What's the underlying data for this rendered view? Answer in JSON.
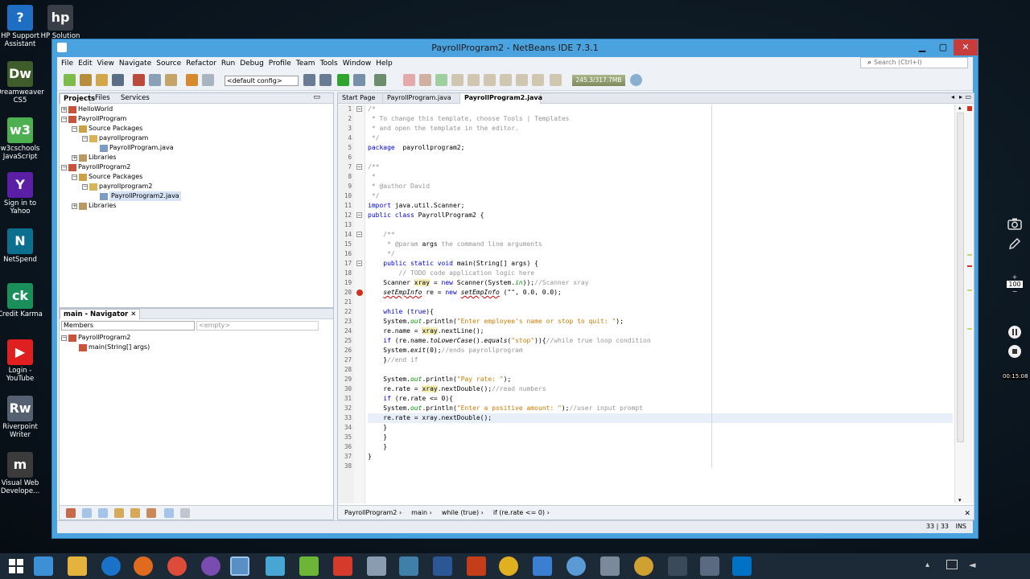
{
  "desktop": {
    "icons": [
      {
        "label": "HP Support Assistant",
        "color": "#1e6fc4",
        "glyph": "?"
      },
      {
        "label": "HP Solution",
        "color": "#3a3f47",
        "glyph": "hp"
      },
      {
        "label": "Dreamweaver CS5",
        "color": "#3e5d2a",
        "glyph": "Dw"
      },
      {
        "label": "w3cschools JavaScript",
        "color": "#4caf50",
        "glyph": "w3"
      },
      {
        "label": "Sign in to Yahoo",
        "color": "#5b1fa6",
        "glyph": "Y"
      },
      {
        "label": "NetSpend",
        "color": "#0d6f8f",
        "glyph": "N"
      },
      {
        "label": "Credit Karma",
        "color": "#1a8f5a",
        "glyph": "ck"
      },
      {
        "label": "Login - YouTube",
        "color": "#e02020",
        "glyph": "▶"
      },
      {
        "label": "Riverpoint Writer",
        "color": "#556070",
        "glyph": "Rw"
      },
      {
        "label": "Visual Web Develope...",
        "color": "#3b3b3b",
        "glyph": "m"
      }
    ],
    "side_tools": {
      "zoom": "100",
      "timer": "00:15:08"
    }
  },
  "window": {
    "title": "PayrollProgram2 - NetBeans IDE 7.3.1",
    "menu": [
      "File",
      "Edit",
      "View",
      "Navigate",
      "Source",
      "Refactor",
      "Run",
      "Debug",
      "Profile",
      "Team",
      "Tools",
      "Window",
      "Help"
    ],
    "search_placeholder": "Search (Ctrl+I)",
    "config": "<default config>",
    "memory": "245.3/317.7MB"
  },
  "projects": {
    "tabs": [
      "Projects",
      "Files",
      "Services"
    ],
    "tree": [
      {
        "label": "HelloWorld",
        "depth": 0,
        "kind": "project",
        "exp": "+"
      },
      {
        "label": "PayrollProgram",
        "depth": 0,
        "kind": "project",
        "exp": "−"
      },
      {
        "label": "Source Packages",
        "depth": 1,
        "kind": "folder",
        "exp": "−"
      },
      {
        "label": "payrollprogram",
        "depth": 2,
        "kind": "package",
        "exp": "−"
      },
      {
        "label": "PayrollProgram.java",
        "depth": 3,
        "kind": "java",
        "exp": ""
      },
      {
        "label": "Libraries",
        "depth": 1,
        "kind": "lib",
        "exp": "+"
      },
      {
        "label": "PayrollProgram2",
        "depth": 0,
        "kind": "project",
        "exp": "−"
      },
      {
        "label": "Source Packages",
        "depth": 1,
        "kind": "folder",
        "exp": "−"
      },
      {
        "label": "payrollprogram2",
        "depth": 2,
        "kind": "package",
        "exp": "−"
      },
      {
        "label": "PayrollProgram2.java",
        "depth": 3,
        "kind": "java",
        "exp": "",
        "selected": true
      },
      {
        "label": "Libraries",
        "depth": 1,
        "kind": "lib",
        "exp": "+"
      }
    ]
  },
  "navigator": {
    "title": "main - Navigator",
    "filter": "Members",
    "filter2": "<empty>",
    "tree": [
      {
        "label": "PayrollProgram2",
        "depth": 0
      },
      {
        "label": "main(String[] args)",
        "depth": 1
      }
    ]
  },
  "editor": {
    "tabs": [
      {
        "label": "Start Page",
        "active": false
      },
      {
        "label": "PayrollProgram.java",
        "active": false
      },
      {
        "label": "PayrollProgram2.java",
        "active": true
      }
    ],
    "current_line": 33,
    "breadcrumb": [
      "PayrollProgram2",
      "main",
      "while (true)",
      "if (re.rate <= 0)"
    ],
    "status_pos": "33 | 33",
    "status_mode": "INS"
  }
}
